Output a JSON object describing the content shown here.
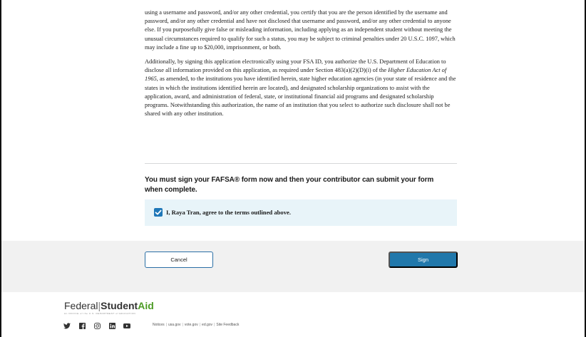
{
  "terms": {
    "paragraph_1": "using a username and password, and/or any other credential, you certify that you are the person identified by the username and password, and/or any other credential and have not disclosed that username and password, and/or any other credential to anyone else. If you purposefully give false or misleading information, including applying as an independent student without meeting the unusual circumstances required to qualify for such a status, you may be subject to criminal penalties under 20 U.S.C. 1097, which may include a fine up to $20,000, imprisonment, or both.",
    "paragraph_2_before": "Additionally, by signing this application electronically using your FSA ID, you authorize the U.S. Department of Education to disclose all information provided on this application, as required under Section 483(a)(2)(D)(i) of the ",
    "paragraph_2_italic": "Higher Education Act of 1965",
    "paragraph_2_after": ", as amended, to the institutions you have identified herein, state higher education agencies (in your state of residence and the states in which the institutions identified herein are located), and designated scholarship organizations to assist with the application, award, and administration of federal, state, or institutional financial aid programs and designated scholarship programs.  Notwithstanding this authorization, the name of an institution that you select to authorize such disclosure shall not be shared with any other institution."
  },
  "sign_section": {
    "title": "You must sign your FAFSA® form now and then your contributor can submit your form when complete.",
    "agree_label": "I, Raya Tran, agree to the terms outlined above.",
    "agree_checked": true
  },
  "actions": {
    "cancel_label": "Cancel",
    "sign_label": "Sign"
  },
  "footer": {
    "logo_federal": "Federal",
    "logo_separator": "|",
    "logo_student": "Student",
    "logo_aid": "Aid",
    "logo_tagline": "An OFFICE of the U.S. DEPARTMENT of EDUCATION",
    "social_icons": [
      "twitter-icon",
      "facebook-icon",
      "instagram-icon",
      "linkedin-icon",
      "youtube-icon"
    ],
    "links": [
      "Notices",
      "usa.gov",
      "vote.gov",
      "ed.gov",
      "Site Feedback"
    ]
  },
  "colors": {
    "primary_blue": "#2178ab",
    "agree_bg": "#e8f4f9",
    "action_band": "#f1f1f1",
    "aid_green": "#4c9b24"
  }
}
